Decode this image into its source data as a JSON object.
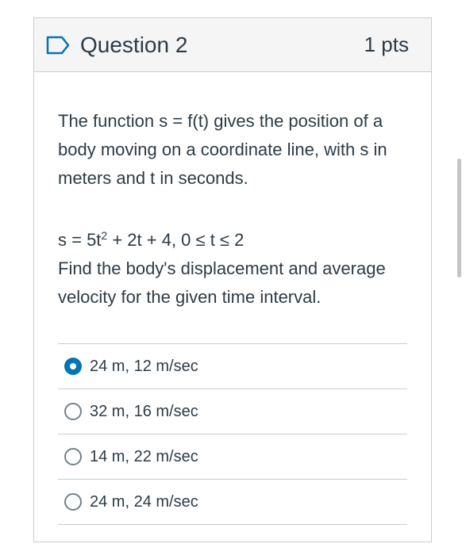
{
  "question": {
    "title": "Question 2",
    "points": "1 pts",
    "text_part1": "The function s = f(t) gives the position of a body moving on a coordinate line, with s in meters and t in seconds.",
    "equation_pre": "s = 5t",
    "equation_sup": "2",
    "equation_post": " + 2t + 4, 0 ≤ t ≤ 2",
    "text_part2": "Find the body's displacement and average velocity for the given time interval."
  },
  "answers": [
    {
      "label": "24 m, 12 m/sec",
      "selected": true
    },
    {
      "label": "32 m, 16 m/sec",
      "selected": false
    },
    {
      "label": "14 m, 22 m/sec",
      "selected": false
    },
    {
      "label": "24 m, 24 m/sec",
      "selected": false
    }
  ],
  "colors": {
    "accent": "#0374b5",
    "text": "#2d3b45",
    "border": "#c7cdd1",
    "header_bg": "#f5f5f5"
  },
  "icons": {
    "flag": "bookmark-flag-icon"
  }
}
